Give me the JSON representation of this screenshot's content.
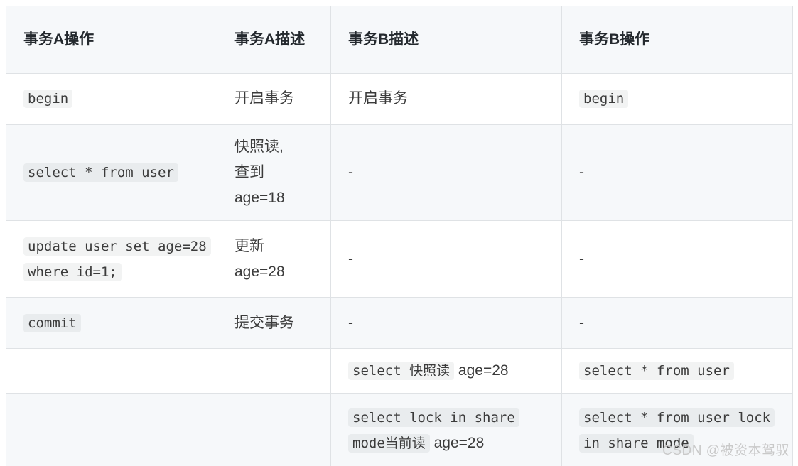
{
  "table": {
    "headers": [
      "事务A操作",
      "事务A描述",
      "事务B描述",
      "事务B操作"
    ],
    "rows": [
      {
        "a_op_code": "begin",
        "a_desc": "开启事务",
        "b_desc": "开启事务",
        "b_op_code": "begin"
      },
      {
        "a_op_code": "select * from user",
        "a_desc": "快照读,\n查到\nage=18",
        "b_desc": "-",
        "b_op_code": "-"
      },
      {
        "a_op_code": "update user set age=28 where id=1;",
        "a_desc": "更新\nage=28",
        "b_desc": "-",
        "b_op_code": "-"
      },
      {
        "a_op_code": "commit",
        "a_desc": "提交事务",
        "b_desc": "-",
        "b_op_code": "-"
      },
      {
        "a_op_code": "",
        "a_desc": "",
        "b_desc_code": "select 快照读",
        "b_desc_tail": " age=28",
        "b_op_code": "select * from user"
      },
      {
        "a_op_code": "",
        "a_desc": "",
        "b_desc_code": "select lock in share mode当前读",
        "b_desc_tail": " age=28",
        "b_op_code": "select * from user lock in share mode"
      }
    ]
  },
  "watermark": {
    "text": "CSDN @被资本驾驭"
  },
  "colors": {
    "header_bg": "#f6f8fa",
    "stripe_bg": "#f6f8fa",
    "border": "#dfe2e5",
    "code_bg": "rgba(27,31,35,0.055)",
    "text": "#3b3b3b",
    "watermark": "#c9c9c9"
  }
}
